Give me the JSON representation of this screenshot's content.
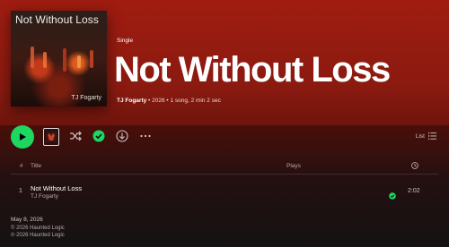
{
  "album": {
    "cover_title": "Not Without Loss",
    "cover_artist": "TJ Fogarty",
    "type_label": "Single",
    "title": "Not Without Loss",
    "artist": "TJ Fogarty",
    "meta_rest": " • 2026 • 1 song, 2 min 2 sec"
  },
  "actions": {
    "play": "play-icon",
    "shuffle": "shuffle-icon",
    "saved": "check-circle-icon",
    "download": "download-icon",
    "more": "more-icon",
    "list_label": "List"
  },
  "table": {
    "headers": {
      "num": "#",
      "title": "Title",
      "plays": "Plays"
    },
    "rows": [
      {
        "num": "1",
        "title": "Not Without Loss",
        "artist": "TJ Fogarty",
        "plays": "",
        "duration": "2:02"
      }
    ]
  },
  "footer": {
    "date": "May 8, 2026",
    "copyright": "© 2026 Haunted Logic",
    "phonographic": "℗ 2026 Haunted Logic"
  },
  "colors": {
    "accent": "#1ed760",
    "header": "#a01c10"
  }
}
